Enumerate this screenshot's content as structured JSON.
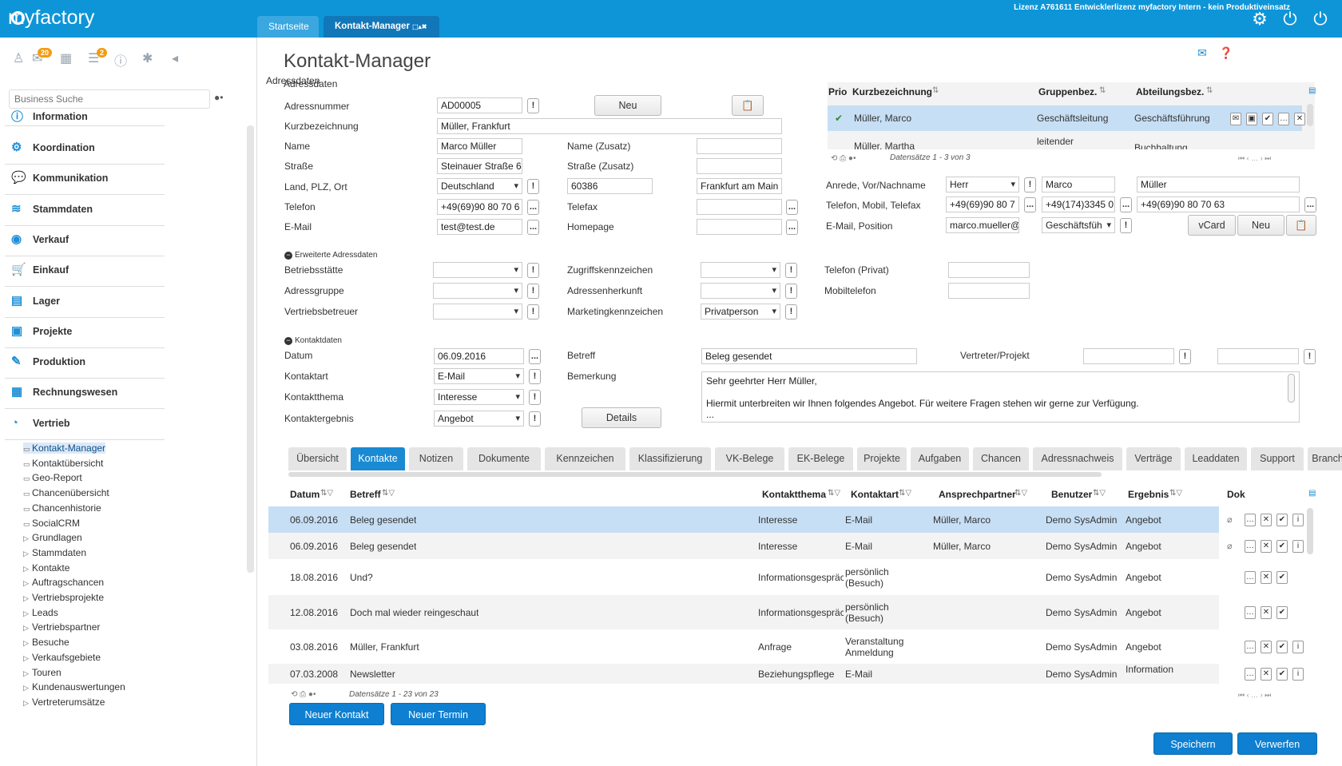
{
  "topbar": {
    "logo": "myfactory",
    "license": "Lizenz A761611 Entwicklerlizenz myfactory Intern - kein Produktiveinsatz",
    "tabs": [
      {
        "label": "Startseite"
      },
      {
        "label": "Kontakt-Manager"
      }
    ]
  },
  "sidebar": {
    "badge1": "20",
    "badge2": "2",
    "search_placeholder": "Business Suche",
    "nav": [
      "Information",
      "Koordination",
      "Kommunikation",
      "Stammdaten",
      "Verkauf",
      "Einkauf",
      "Lager",
      "Projekte",
      "Produktion",
      "Rechnungswesen",
      "Vertrieb"
    ],
    "sub": [
      "Kontakt-Manager",
      "Kontaktübersicht",
      "Geo-Report",
      "Chancenübersicht",
      "Chancenhistorie",
      "SocialCRM",
      "Grundlagen",
      "Stammdaten",
      "Kontakte",
      "Auftragschancen",
      "Vertriebsprojekte",
      "Leads",
      "Vertriebspartner",
      "Besuche",
      "Verkaufsgebiete",
      "Touren",
      "Kundenauswertungen",
      "Vertreterumsätze"
    ]
  },
  "page": {
    "title": "Kontakt-Manager",
    "sec_address": "Adressdaten",
    "sec_extended": "Erweiterte Adressdaten",
    "sec_contact": "Kontaktdaten"
  },
  "address": {
    "l_nr": "Adressnummer",
    "nr": "AD00005",
    "btn_new": "Neu",
    "l_kurz": "Kurzbezeichnung",
    "kurz": "Müller, Frankfurt",
    "l_name": "Name",
    "name": "Marco Müller",
    "l_name2": "Name (Zusatz)",
    "l_street": "Straße",
    "street": "Steinauer Straße 6",
    "l_street2": "Straße (Zusatz)",
    "l_land": "Land, PLZ, Ort",
    "land": "Deutschland",
    "plz": "60386",
    "ort": "Frankfurt am Main",
    "l_tel": "Telefon",
    "tel": "+49(69)90 80 70 6",
    "l_fax": "Telefax",
    "l_mail": "E-Mail",
    "mail": "test@test.de",
    "l_home": "Homepage"
  },
  "extended": {
    "l_betr": "Betriebsstätte",
    "l_grp": "Adressgruppe",
    "l_vb": "Vertriebsbetreuer",
    "l_zug": "Zugriffskennzeichen",
    "l_herk": "Adressenherkunft",
    "l_mark": "Marketingkennzeichen",
    "mark": "Privatperson",
    "l_telp": "Telefon (Privat)",
    "l_mobil": "Mobiltelefon"
  },
  "contacts_grid": {
    "headers": [
      "Prio",
      "Kurzbezeichnung",
      "Gruppenbez.",
      "Abteilungsbez."
    ],
    "rows": [
      {
        "name": "Müller, Marco",
        "group": "Geschäftsleitung",
        "dept": "Geschäftsführung"
      },
      {
        "name": "Müller, Martha",
        "group": "leitender",
        "dept": "Buchhaltung"
      }
    ],
    "pager": "Datensätze 1 - 3 von 3"
  },
  "person": {
    "l_anrede": "Anrede, Vor/Nachname",
    "anrede": "Herr",
    "vorname": "Marco",
    "nachname": "Müller",
    "l_tel": "Telefon, Mobil, Telefax",
    "tel": "+49(69)90 80 7",
    "mobil": "+49(174)3345 0",
    "fax": "+49(69)90 80 70 63",
    "l_mail": "E-Mail, Position",
    "mail": "marco.mueller@",
    "pos": "Geschäftsfüh",
    "btn_vcard": "vCard",
    "btn_new": "Neu"
  },
  "contact": {
    "l_datum": "Datum",
    "datum": "06.09.2016",
    "l_betreff": "Betreff",
    "betreff": "Beleg gesendet",
    "l_vertr": "Vertreter/Projekt",
    "l_art": "Kontaktart",
    "art": "E-Mail",
    "l_bem": "Bemerkung",
    "bem1": "Sehr geehrter Herr Müller,",
    "bem2": "Hiermit unterbreiten wir Ihnen folgendes Angebot. Für weitere Fragen stehen wir gerne zur Verfügung.",
    "bem3": "...",
    "l_thema": "Kontaktthema",
    "thema": "Interesse",
    "l_erg": "Kontaktergebnis",
    "erg": "Angebot",
    "btn_details": "Details"
  },
  "tabs": [
    "Übersicht",
    "Kontakte",
    "Notizen",
    "Dokumente",
    "Kennzeichen",
    "Klassifizierung",
    "VK-Belege",
    "EK-Belege",
    "Projekte",
    "Aufgaben",
    "Chancen",
    "Adressnachweis",
    "Verträge",
    "Leaddaten",
    "Support",
    "Branchen"
  ],
  "grid": {
    "headers": [
      "Datum",
      "Betreff",
      "Kontaktthema",
      "Kontaktart",
      "Ansprechpartner",
      "Benutzer",
      "Ergebnis",
      "Dok"
    ],
    "rows": [
      {
        "d": "06.09.2016",
        "b": "Beleg gesendet",
        "t": "Interesse",
        "a": "E-Mail",
        "a2": "",
        "p": "Müller, Marco",
        "u": "Demo SysAdmin",
        "e": "Angebot"
      },
      {
        "d": "06.09.2016",
        "b": "Beleg gesendet",
        "t": "Interesse",
        "a": "E-Mail",
        "a2": "",
        "p": "Müller, Marco",
        "u": "Demo SysAdmin",
        "e": "Angebot"
      },
      {
        "d": "18.08.2016",
        "b": "Und?",
        "t": "Informationsgespräch",
        "a": "persönlich",
        "a2": "(Besuch)",
        "p": "",
        "u": "Demo SysAdmin",
        "e": "Angebot"
      },
      {
        "d": "12.08.2016",
        "b": "Doch mal wieder reingeschaut",
        "t": "Informationsgespräch",
        "a": "persönlich",
        "a2": "(Besuch)",
        "p": "",
        "u": "Demo SysAdmin",
        "e": "Angebot"
      },
      {
        "d": "03.08.2016",
        "b": "Müller, Frankfurt",
        "t": "Anfrage",
        "a": "Veranstaltung",
        "a2": "Anmeldung",
        "p": "",
        "u": "Demo SysAdmin",
        "e": "Angebot"
      },
      {
        "d": "07.03.2008",
        "b": "Newsletter",
        "t": "Beziehungspflege",
        "a": "E-Mail",
        "a2": "",
        "p": "",
        "u": "Demo SysAdmin",
        "e": "Information"
      }
    ],
    "pager": "Datensätze 1 - 23 von 23"
  },
  "buttons": {
    "new_contact": "Neuer Kontakt",
    "new_appt": "Neuer Termin",
    "save": "Speichern",
    "discard": "Verwerfen"
  },
  "colors": {
    "brand": "#0e95d8",
    "selected_row": "#c7dff5",
    "active_tab": "#1a8ad3"
  }
}
